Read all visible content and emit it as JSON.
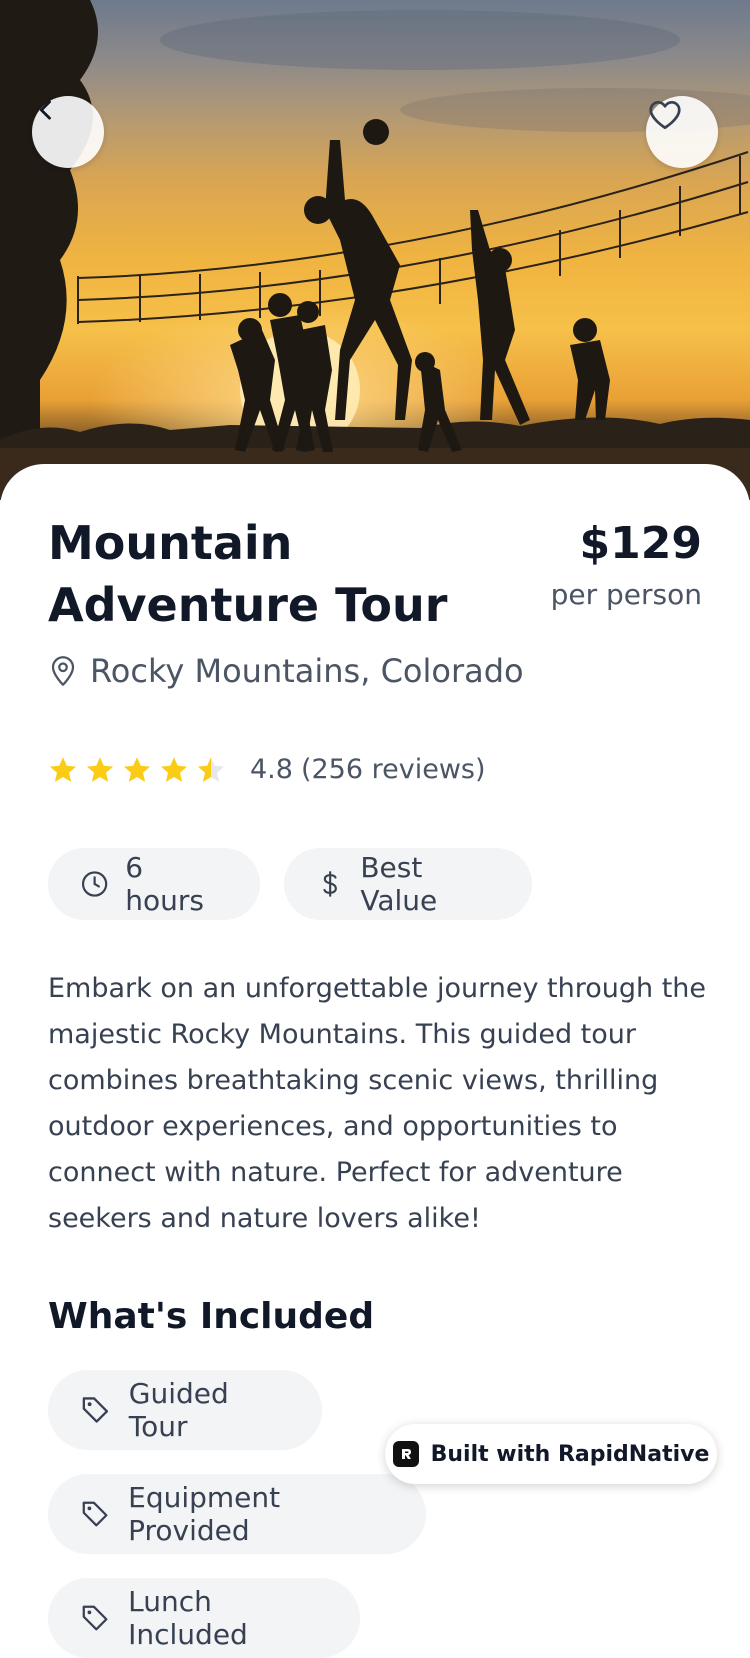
{
  "tour": {
    "title": "Mountain Adventure Tour",
    "price": "$129",
    "price_unit": "per person",
    "location": "Rocky Mountains, Colorado",
    "rating_value": "4.8",
    "rating_count": "(256 reviews)",
    "rating_stars": 4.5,
    "duration": "6 hours",
    "value_tag": "Best Value",
    "description": "Embark on an unforgettable journey through the majestic Rocky Mountains. This guided tour combines breathtaking scenic views, thrilling outdoor experiences, and opportunities to connect with nature. Perfect for adventure seekers and nature lovers alike!"
  },
  "included": {
    "title": "What's Included",
    "items": [
      "Guided Tour",
      "Equipment Provided",
      "Lunch Included"
    ]
  },
  "badge": {
    "label": "Built with RapidNative"
  },
  "colors": {
    "star": "#facc15",
    "chip_bg": "#f3f4f6",
    "text_primary": "#111827",
    "text_secondary": "#4b5563"
  },
  "icons": {
    "back": "chevron-left-icon",
    "favorite": "heart-icon",
    "location": "map-pin-icon",
    "duration": "clock-icon",
    "value": "dollar-icon",
    "included": "tag-icon"
  }
}
